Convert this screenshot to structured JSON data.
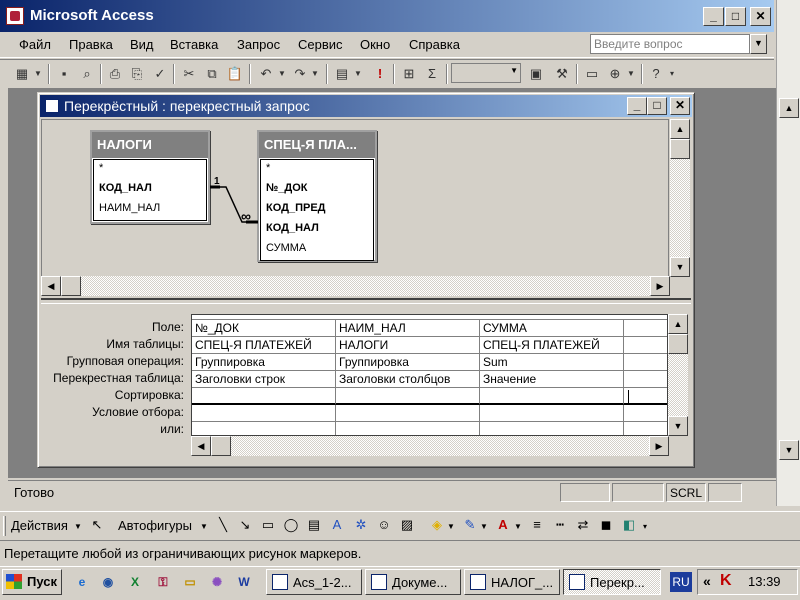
{
  "app": {
    "title": "Microsoft Access"
  },
  "menu": {
    "items": [
      "Файл",
      "Правка",
      "Вид",
      "Вставка",
      "Запрос",
      "Сервис",
      "Окно",
      "Справка"
    ],
    "help_placeholder": "Введите вопрос"
  },
  "child_window": {
    "title": "Перекрёстный : перекрестный запрос"
  },
  "tables": [
    {
      "name": "НАЛОГИ",
      "fields": [
        "*",
        "КОД_НАЛ",
        "НАИМ_НАЛ"
      ],
      "bold": [
        false,
        true,
        false
      ]
    },
    {
      "name": "СПЕЦ-Я ПЛА...",
      "fields": [
        "*",
        "№_ДОК",
        "КОД_ПРЕД",
        "КОД_НАЛ",
        "СУММА"
      ],
      "bold": [
        false,
        true,
        true,
        true,
        false
      ]
    }
  ],
  "relationship": {
    "one_label": "1",
    "many_label": "∞"
  },
  "qbe": {
    "row_labels": [
      "Поле:",
      "Имя таблицы:",
      "Групповая операция:",
      "Перекрестная таблица:",
      "Сортировка:",
      "Условие отбора:",
      "или:"
    ],
    "columns": [
      [
        "№_ДОК",
        "СПЕЦ-Я ПЛАТЕЖЕЙ",
        "Группировка",
        "Заголовки строк",
        "",
        "",
        ""
      ],
      [
        "НАИМ_НАЛ",
        "НАЛОГИ",
        "Группировка",
        "Заголовки столбцов",
        "",
        "",
        ""
      ],
      [
        "СУММА",
        "СПЕЦ-Я ПЛАТЕЖЕЙ",
        "Sum",
        "Значение",
        "",
        "",
        ""
      ],
      [
        "",
        "",
        "",
        "",
        "",
        "",
        ""
      ]
    ]
  },
  "status": {
    "text": "Готово",
    "scrl": "SCRL"
  },
  "drawing_toolbar": {
    "actions": "Действия",
    "autoshapes": "Автофигуры"
  },
  "hint": "Перетащите любой из ограничивающих рисунок маркеров.",
  "taskbar": {
    "start": "Пуск",
    "tasks": [
      "Acs_1-2...",
      "Докуме...",
      "НАЛОГ_...",
      "Перекр..."
    ],
    "lang": "RU",
    "clock": "13:39"
  }
}
